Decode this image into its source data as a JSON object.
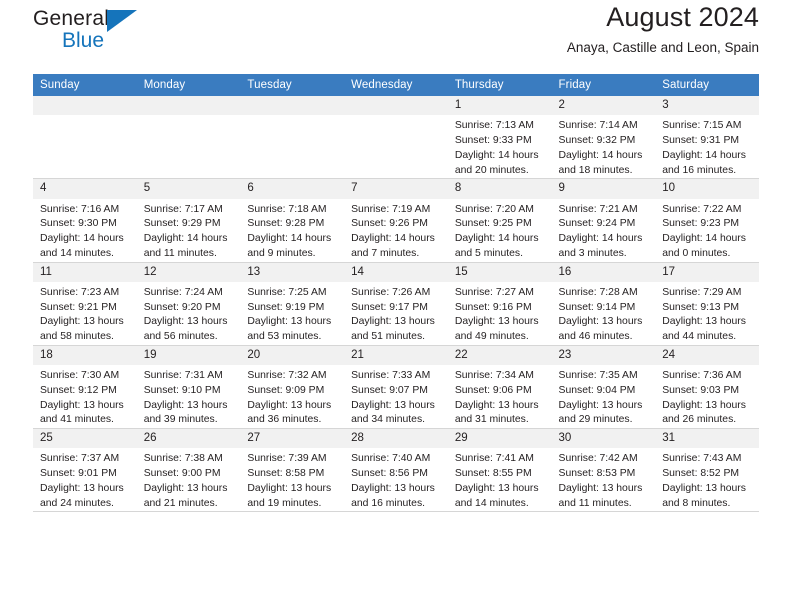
{
  "brand": {
    "name_part1": "General",
    "name_part2": "Blue",
    "triangle_color": "#1574bb"
  },
  "header": {
    "title": "August 2024",
    "subtitle": "Anaya, Castille and Leon, Spain"
  },
  "theme": {
    "header_row_color": "#3a7cc0",
    "daynum_bg": "#f1f1f1",
    "text_color": "#231f20",
    "grid_line": "#d6d6d6"
  },
  "weekdays": [
    "Sunday",
    "Monday",
    "Tuesday",
    "Wednesday",
    "Thursday",
    "Friday",
    "Saturday"
  ],
  "labels": {
    "sunrise_prefix": "Sunrise: ",
    "sunset_prefix": "Sunset: ",
    "daylight_prefix": "Daylight: "
  },
  "chart_data": {
    "type": "table",
    "title": "August 2024",
    "subtitle": "Anaya, Castille and Leon, Spain",
    "columns": [
      "Sunday",
      "Monday",
      "Tuesday",
      "Wednesday",
      "Thursday",
      "Friday",
      "Saturday"
    ],
    "fields": [
      "day",
      "sunrise",
      "sunset",
      "daylight"
    ],
    "rows": [
      [
        {
          "day": "",
          "blank": true
        },
        {
          "day": "",
          "blank": true
        },
        {
          "day": "",
          "blank": true
        },
        {
          "day": "",
          "blank": true
        },
        {
          "day": "1",
          "sunrise": "Sunrise: 7:13 AM",
          "sunset": "Sunset: 9:33 PM",
          "daylight": "Daylight: 14 hours and 20 minutes."
        },
        {
          "day": "2",
          "sunrise": "Sunrise: 7:14 AM",
          "sunset": "Sunset: 9:32 PM",
          "daylight": "Daylight: 14 hours and 18 minutes."
        },
        {
          "day": "3",
          "sunrise": "Sunrise: 7:15 AM",
          "sunset": "Sunset: 9:31 PM",
          "daylight": "Daylight: 14 hours and 16 minutes."
        }
      ],
      [
        {
          "day": "4",
          "sunrise": "Sunrise: 7:16 AM",
          "sunset": "Sunset: 9:30 PM",
          "daylight": "Daylight: 14 hours and 14 minutes."
        },
        {
          "day": "5",
          "sunrise": "Sunrise: 7:17 AM",
          "sunset": "Sunset: 9:29 PM",
          "daylight": "Daylight: 14 hours and 11 minutes."
        },
        {
          "day": "6",
          "sunrise": "Sunrise: 7:18 AM",
          "sunset": "Sunset: 9:28 PM",
          "daylight": "Daylight: 14 hours and 9 minutes."
        },
        {
          "day": "7",
          "sunrise": "Sunrise: 7:19 AM",
          "sunset": "Sunset: 9:26 PM",
          "daylight": "Daylight: 14 hours and 7 minutes."
        },
        {
          "day": "8",
          "sunrise": "Sunrise: 7:20 AM",
          "sunset": "Sunset: 9:25 PM",
          "daylight": "Daylight: 14 hours and 5 minutes."
        },
        {
          "day": "9",
          "sunrise": "Sunrise: 7:21 AM",
          "sunset": "Sunset: 9:24 PM",
          "daylight": "Daylight: 14 hours and 3 minutes."
        },
        {
          "day": "10",
          "sunrise": "Sunrise: 7:22 AM",
          "sunset": "Sunset: 9:23 PM",
          "daylight": "Daylight: 14 hours and 0 minutes."
        }
      ],
      [
        {
          "day": "11",
          "sunrise": "Sunrise: 7:23 AM",
          "sunset": "Sunset: 9:21 PM",
          "daylight": "Daylight: 13 hours and 58 minutes."
        },
        {
          "day": "12",
          "sunrise": "Sunrise: 7:24 AM",
          "sunset": "Sunset: 9:20 PM",
          "daylight": "Daylight: 13 hours and 56 minutes."
        },
        {
          "day": "13",
          "sunrise": "Sunrise: 7:25 AM",
          "sunset": "Sunset: 9:19 PM",
          "daylight": "Daylight: 13 hours and 53 minutes."
        },
        {
          "day": "14",
          "sunrise": "Sunrise: 7:26 AM",
          "sunset": "Sunset: 9:17 PM",
          "daylight": "Daylight: 13 hours and 51 minutes."
        },
        {
          "day": "15",
          "sunrise": "Sunrise: 7:27 AM",
          "sunset": "Sunset: 9:16 PM",
          "daylight": "Daylight: 13 hours and 49 minutes."
        },
        {
          "day": "16",
          "sunrise": "Sunrise: 7:28 AM",
          "sunset": "Sunset: 9:14 PM",
          "daylight": "Daylight: 13 hours and 46 minutes."
        },
        {
          "day": "17",
          "sunrise": "Sunrise: 7:29 AM",
          "sunset": "Sunset: 9:13 PM",
          "daylight": "Daylight: 13 hours and 44 minutes."
        }
      ],
      [
        {
          "day": "18",
          "sunrise": "Sunrise: 7:30 AM",
          "sunset": "Sunset: 9:12 PM",
          "daylight": "Daylight: 13 hours and 41 minutes."
        },
        {
          "day": "19",
          "sunrise": "Sunrise: 7:31 AM",
          "sunset": "Sunset: 9:10 PM",
          "daylight": "Daylight: 13 hours and 39 minutes."
        },
        {
          "day": "20",
          "sunrise": "Sunrise: 7:32 AM",
          "sunset": "Sunset: 9:09 PM",
          "daylight": "Daylight: 13 hours and 36 minutes."
        },
        {
          "day": "21",
          "sunrise": "Sunrise: 7:33 AM",
          "sunset": "Sunset: 9:07 PM",
          "daylight": "Daylight: 13 hours and 34 minutes."
        },
        {
          "day": "22",
          "sunrise": "Sunrise: 7:34 AM",
          "sunset": "Sunset: 9:06 PM",
          "daylight": "Daylight: 13 hours and 31 minutes."
        },
        {
          "day": "23",
          "sunrise": "Sunrise: 7:35 AM",
          "sunset": "Sunset: 9:04 PM",
          "daylight": "Daylight: 13 hours and 29 minutes."
        },
        {
          "day": "24",
          "sunrise": "Sunrise: 7:36 AM",
          "sunset": "Sunset: 9:03 PM",
          "daylight": "Daylight: 13 hours and 26 minutes."
        }
      ],
      [
        {
          "day": "25",
          "sunrise": "Sunrise: 7:37 AM",
          "sunset": "Sunset: 9:01 PM",
          "daylight": "Daylight: 13 hours and 24 minutes."
        },
        {
          "day": "26",
          "sunrise": "Sunrise: 7:38 AM",
          "sunset": "Sunset: 9:00 PM",
          "daylight": "Daylight: 13 hours and 21 minutes."
        },
        {
          "day": "27",
          "sunrise": "Sunrise: 7:39 AM",
          "sunset": "Sunset: 8:58 PM",
          "daylight": "Daylight: 13 hours and 19 minutes."
        },
        {
          "day": "28",
          "sunrise": "Sunrise: 7:40 AM",
          "sunset": "Sunset: 8:56 PM",
          "daylight": "Daylight: 13 hours and 16 minutes."
        },
        {
          "day": "29",
          "sunrise": "Sunrise: 7:41 AM",
          "sunset": "Sunset: 8:55 PM",
          "daylight": "Daylight: 13 hours and 14 minutes."
        },
        {
          "day": "30",
          "sunrise": "Sunrise: 7:42 AM",
          "sunset": "Sunset: 8:53 PM",
          "daylight": "Daylight: 13 hours and 11 minutes."
        },
        {
          "day": "31",
          "sunrise": "Sunrise: 7:43 AM",
          "sunset": "Sunset: 8:52 PM",
          "daylight": "Daylight: 13 hours and 8 minutes."
        }
      ]
    ]
  }
}
